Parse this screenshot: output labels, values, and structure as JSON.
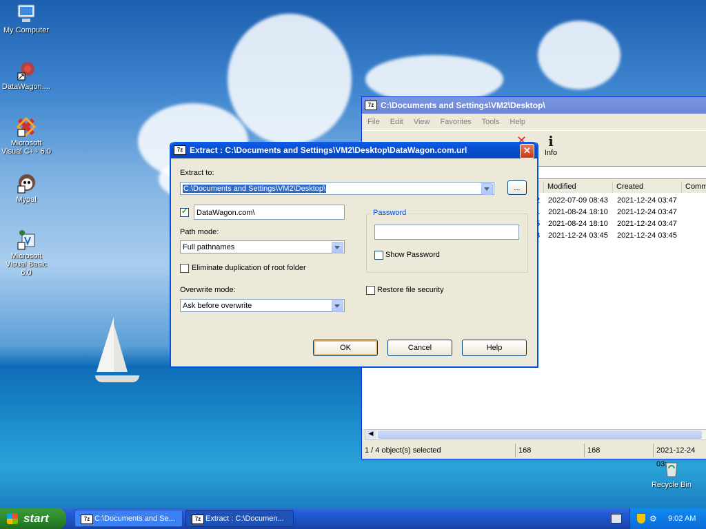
{
  "desktop": {
    "icons": [
      {
        "label": "My Computer",
        "icon": "computer-icon"
      },
      {
        "label": "DataWagon....",
        "icon": "datawagon-shortcut-icon"
      },
      {
        "label": "Microsoft Visual C++ 6.0",
        "icon": "visual-cpp-icon"
      },
      {
        "label": "Mypal",
        "icon": "mypal-icon"
      },
      {
        "label": "Microsoft Visual Basic 6.0",
        "icon": "visual-basic-icon"
      },
      {
        "label": "Recycle Bin",
        "icon": "recycle-bin-icon"
      }
    ]
  },
  "filemanager": {
    "title": "C:\\Documents and Settings\\VM2\\Desktop\\",
    "menu": [
      "File",
      "Edit",
      "View",
      "Favorites",
      "Tools",
      "Help"
    ],
    "info_label": "Info",
    "path_fragment": "\\",
    "columns": [
      "e",
      "Modified",
      "Created",
      "Comm"
    ],
    "rows": [
      {
        "a": "2",
        "modified": "2022-07-09 08:43",
        "created": "2021-12-24 03:47"
      },
      {
        "a": "1",
        "modified": "2021-08-24 18:10",
        "created": "2021-12-24 03:47"
      },
      {
        "a": "5",
        "modified": "2021-08-24 18:10",
        "created": "2021-12-24 03:47"
      },
      {
        "a": "3",
        "modified": "2021-12-24 03:45",
        "created": "2021-12-24 03:45"
      }
    ],
    "status": {
      "selected": "1 / 4 object(s) selected",
      "size": "168",
      "packed": "168",
      "date": "2021-12-24 03:"
    }
  },
  "dialog": {
    "title": "Extract : C:\\Documents and Settings\\VM2\\Desktop\\DataWagon.com.url",
    "extract_to_label": "Extract to:",
    "extract_to_value": "C:\\Documents and Settings\\VM2\\Desktop\\",
    "browse_label": "...",
    "subfolder_value": "DataWagon.com\\",
    "path_mode_label": "Path mode:",
    "path_mode_value": "Full pathnames",
    "eliminate_label": "Eliminate duplication of root folder",
    "overwrite_label": "Overwrite mode:",
    "overwrite_value": "Ask before overwrite",
    "password_group": "Password",
    "show_password_label": "Show Password",
    "restore_security_label": "Restore file security",
    "ok_label": "OK",
    "cancel_label": "Cancel",
    "help_label": "Help"
  },
  "taskbar": {
    "start_label": "start",
    "tasks": [
      "C:\\Documents and Se...",
      "Extract : C:\\Documen..."
    ],
    "clock": "9:02 AM"
  }
}
